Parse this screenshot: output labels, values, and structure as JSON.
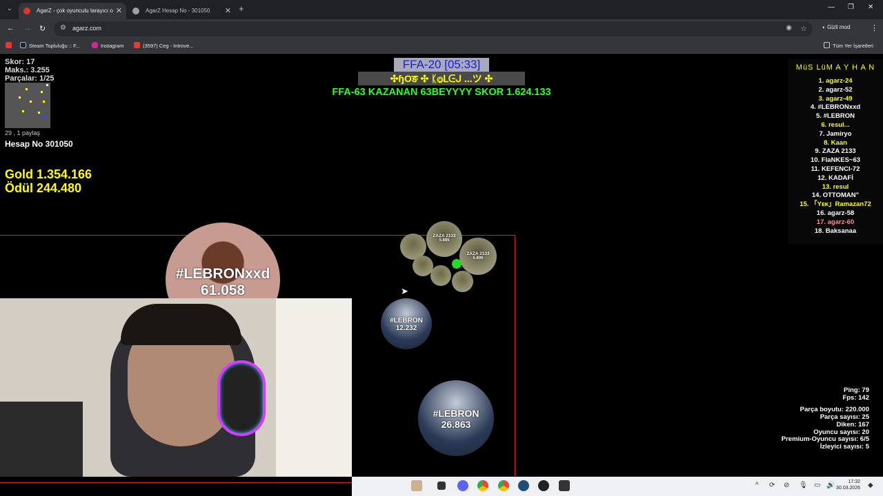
{
  "browser": {
    "tabs": [
      {
        "title": "AgarZ - çok oyunculu tarayıcı o",
        "active": true
      },
      {
        "title": "AgarZ Hesap No - 301050",
        "active": false
      }
    ],
    "url": "agarz.com",
    "incognito_label": "Gizli mod",
    "bookmarks": [
      "Steam Topluluğu :: F...",
      "Instagram",
      "(3597) Ceg - Introve..."
    ],
    "all_bookmarks": "Tüm Yer İşaretleri"
  },
  "hud": {
    "score": "Skor: 17",
    "max": "Maks.: 3.255",
    "parts": "Parçalar: 1/25",
    "share": "29 , 1 paylaş",
    "account": "Hesap No 301050",
    "gold": "Gold 1.354.166",
    "reward": "Ödül 244.480"
  },
  "server": {
    "mode": "FFA-20 [05:33]",
    "clan": "✣ɧΟङ ✣  ᛕⓄᒪᕮᒍ ...ツ  ✣",
    "announcement": "FFA-63 KAZANAN 63BEYYYY SKOR 1.624.133"
  },
  "leaderboard": {
    "title": "MüS LüM A Y H A N",
    "entries": [
      {
        "text": "1. agarz-24",
        "color": "#ffff00"
      },
      {
        "text": "2. agarz-52",
        "color": "#ffffff"
      },
      {
        "text": "3. agarz-49",
        "color": "#ffff00"
      },
      {
        "text": "4. #LEBRONxxd",
        "color": "#ffffff"
      },
      {
        "text": "5. #LEBRON",
        "color": "#ffffff"
      },
      {
        "text": "6. resul...",
        "color": "#ffff00"
      },
      {
        "text": "7. Jamiryo",
        "color": "#ffffff"
      },
      {
        "text": "8. Kaan",
        "color": "#ffff00"
      },
      {
        "text": "9. ZAZA 2133",
        "color": "#ffffff"
      },
      {
        "text": "10. FlaNKES~63",
        "color": "#ffffff"
      },
      {
        "text": "11. KEFENCI-72",
        "color": "#ffffff"
      },
      {
        "text": "12. KADAFİ",
        "color": "#ffffff"
      },
      {
        "text": "13. resul",
        "color": "#ffff00"
      },
      {
        "text": "14. OTTOMAN\"",
        "color": "#ffffff"
      },
      {
        "text": "15. 「Yᴇκ」Ramazan72",
        "color": "#ffff00"
      },
      {
        "text": "16. agarz-58",
        "color": "#ffffff"
      },
      {
        "text": "17. agarz-60",
        "color": "#ff9090"
      },
      {
        "text": "18. Baksanaa",
        "color": "#ffffff"
      }
    ]
  },
  "cells": {
    "lebronxxd": {
      "name": "#LEBRONxxd",
      "mass": "61.058"
    },
    "lebron_small": {
      "name": "#LEBRON",
      "mass": "12.232"
    },
    "lebron_big": {
      "name": "#LEBRON",
      "mass": "26.863"
    },
    "zaza_main": {
      "name": "ZAZA 2133",
      "mass": "5.885"
    },
    "zaza_right": {
      "name": "ZAZA 2133",
      "mass": "5.806"
    }
  },
  "stats": {
    "ping": "Ping: 79",
    "fps": "Fps: 142",
    "part_size": "Parça boyutu: 220.000",
    "part_count": "Parça sayısı: 25",
    "spikes": "Diken: 167",
    "players": "Oyuncu sayısı: 20",
    "premium": "Premium-Oyuncu sayısı: 6/5",
    "viewers": "İzleyici sayısı: 5"
  },
  "taskbar": {
    "time": "17:32",
    "date": "30.03.2026"
  },
  "colors": {
    "announcement": "#2cff2c",
    "gold": "#ffff00",
    "mode_text": "#1b1bdd",
    "border": "#e02020"
  }
}
